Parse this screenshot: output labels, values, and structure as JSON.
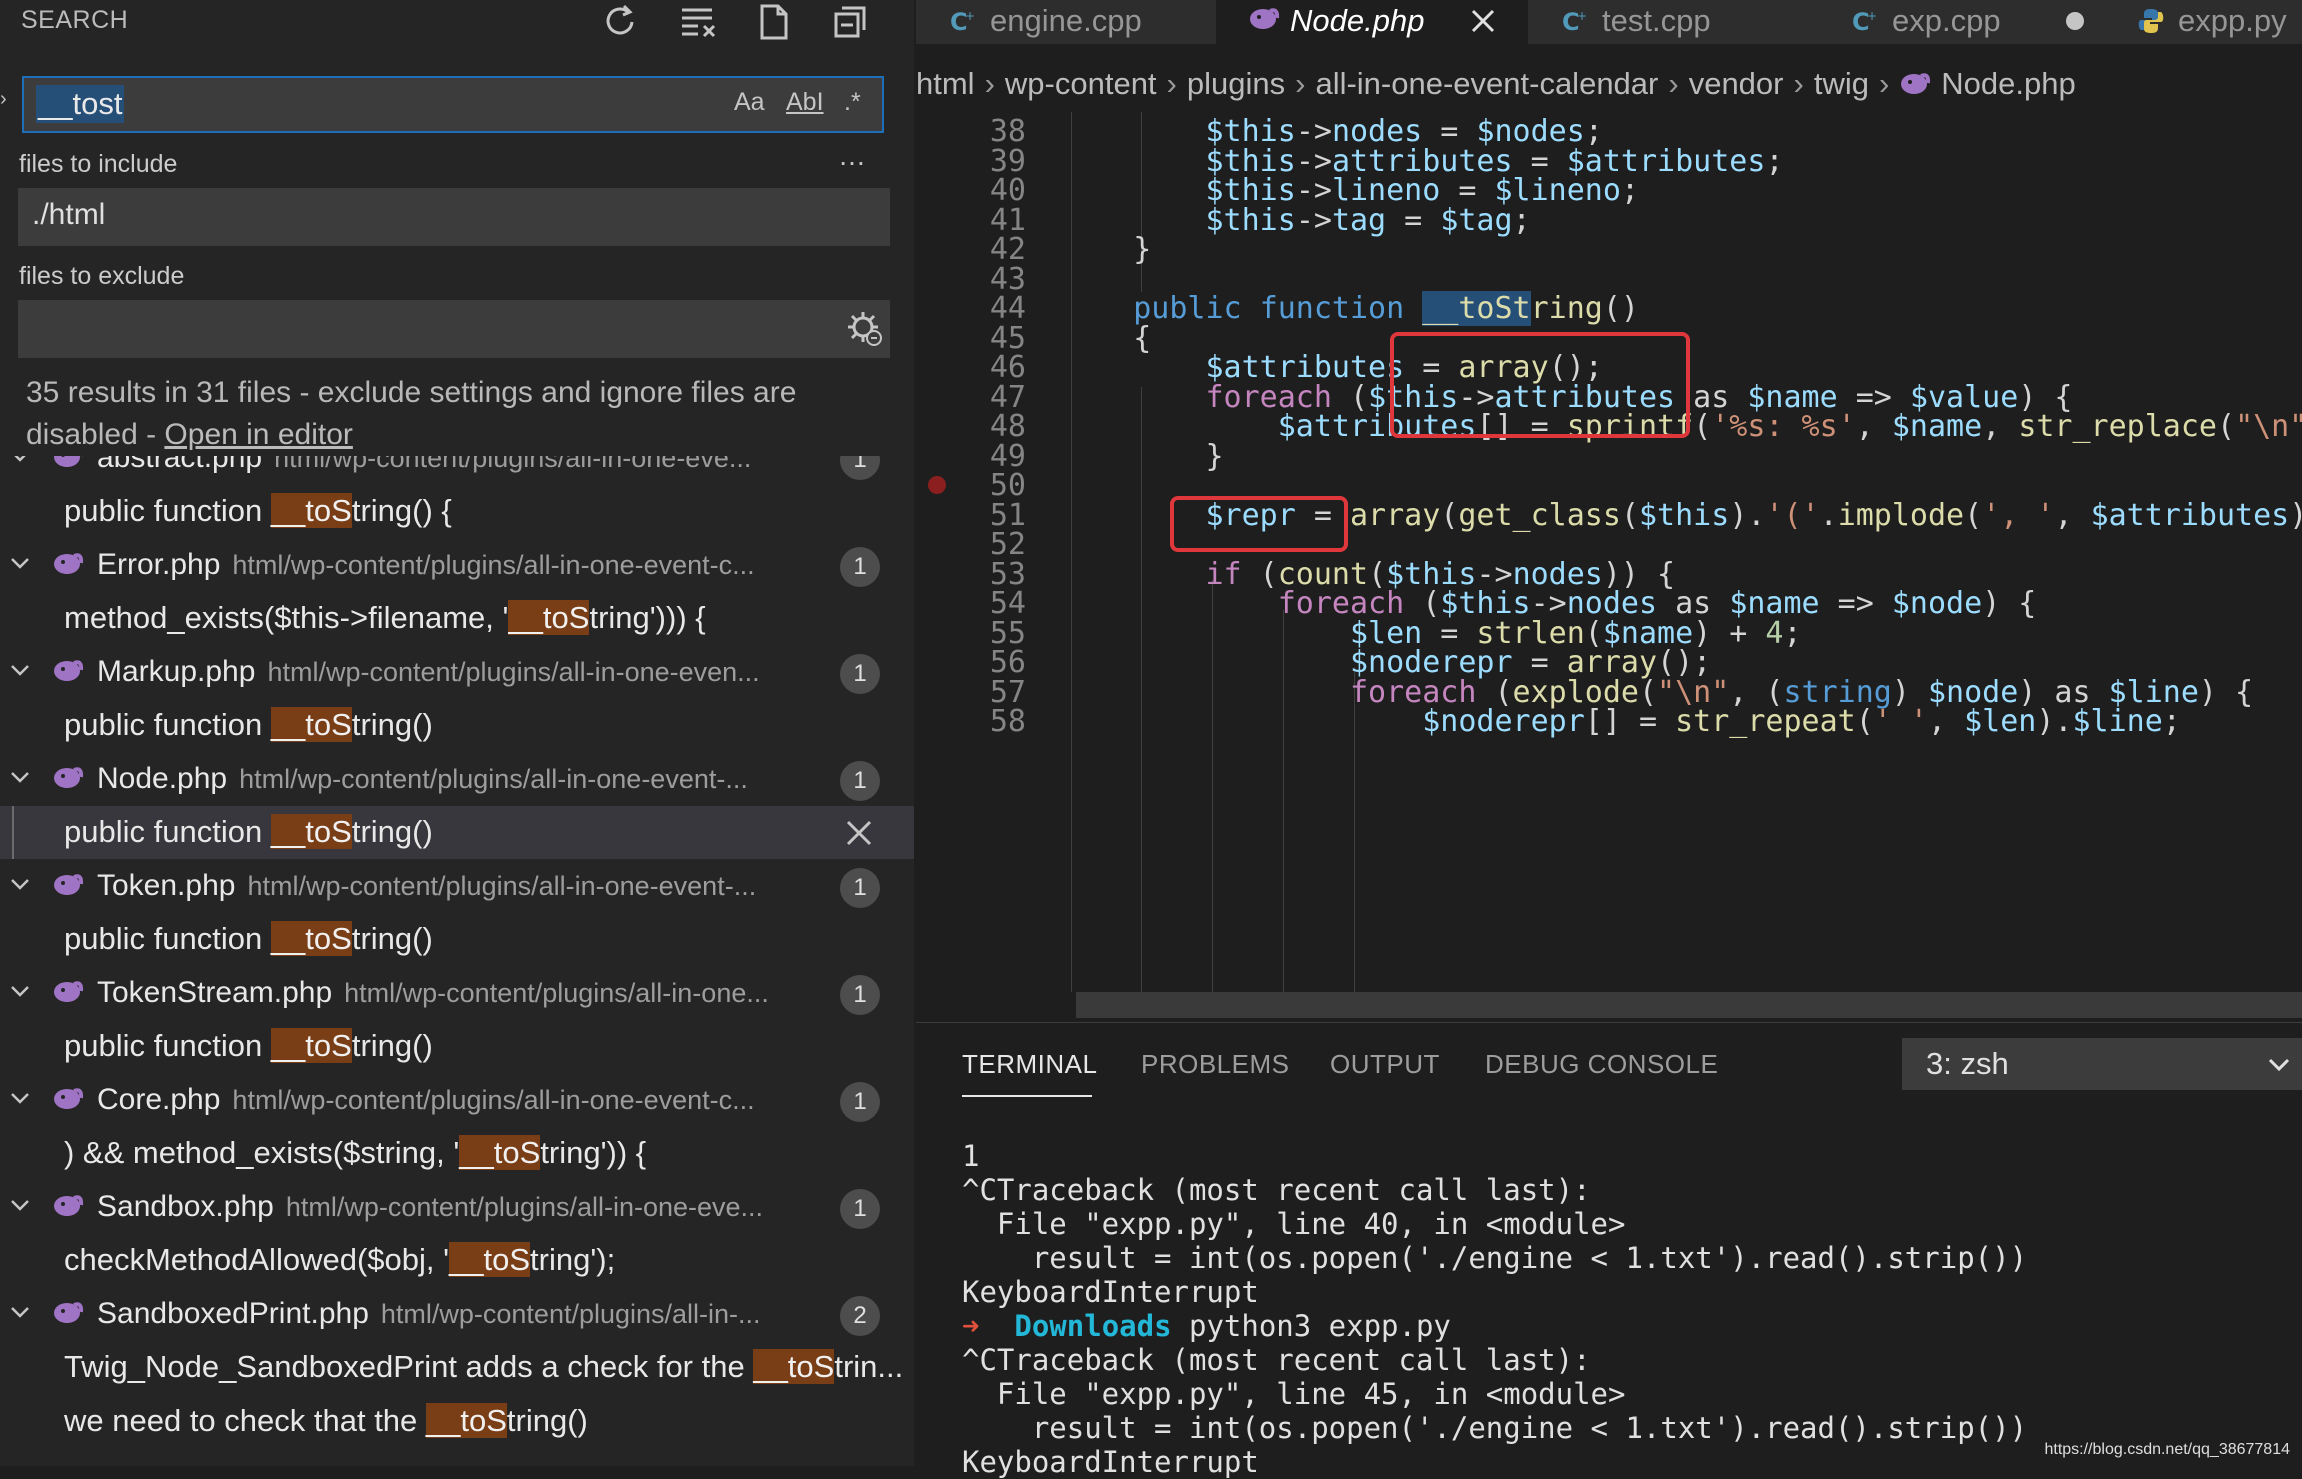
{
  "search_panel": {
    "title": "SEARCH",
    "query": "__tost",
    "option_case": "Aa",
    "option_word": "AbI",
    "option_regex": ".*",
    "more": "…",
    "include_label": "files to include",
    "include_value": "./html",
    "exclude_label": "files to exclude",
    "exclude_value": "",
    "results_message": "35 results in 31 files - exclude settings and ignore files are disabled - ",
    "open_in_editor": "Open in editor",
    "results": [
      {
        "kind": "file",
        "name": "abstract.php",
        "path": "html/wp-content/plugins/all-in-one-eve...",
        "count": "1"
      },
      {
        "kind": "match",
        "pre": "public function ",
        "hl": "__toS",
        "post": "tring() {"
      },
      {
        "kind": "file",
        "name": "Error.php",
        "path": "html/wp-content/plugins/all-in-one-event-c...",
        "count": "1"
      },
      {
        "kind": "match",
        "pre": "method_exists($this->filename, '",
        "hl": "__toS",
        "post": "tring'))) {"
      },
      {
        "kind": "file",
        "name": "Markup.php",
        "path": "html/wp-content/plugins/all-in-one-even...",
        "count": "1"
      },
      {
        "kind": "match",
        "pre": "public function ",
        "hl": "__toS",
        "post": "tring()"
      },
      {
        "kind": "file",
        "name": "Node.php",
        "path": "html/wp-content/plugins/all-in-one-event-...",
        "count": "1"
      },
      {
        "kind": "match",
        "pre": "public function ",
        "hl": "__toS",
        "post": "tring()",
        "active": true
      },
      {
        "kind": "file",
        "name": "Token.php",
        "path": "html/wp-content/plugins/all-in-one-event-...",
        "count": "1"
      },
      {
        "kind": "match",
        "pre": "public function ",
        "hl": "__toS",
        "post": "tring()"
      },
      {
        "kind": "file",
        "name": "TokenStream.php",
        "path": "html/wp-content/plugins/all-in-one...",
        "count": "1"
      },
      {
        "kind": "match",
        "pre": "public function ",
        "hl": "__toS",
        "post": "tring()"
      },
      {
        "kind": "file",
        "name": "Core.php",
        "path": "html/wp-content/plugins/all-in-one-event-c...",
        "count": "1"
      },
      {
        "kind": "match",
        "pre": ") && method_exists($string, '",
        "hl": "__toS",
        "post": "tring')) {"
      },
      {
        "kind": "file",
        "name": "Sandbox.php",
        "path": "html/wp-content/plugins/all-in-one-eve...",
        "count": "1"
      },
      {
        "kind": "match",
        "pre": "checkMethodAllowed($obj, '",
        "hl": "__toS",
        "post": "tring');"
      },
      {
        "kind": "file",
        "name": "SandboxedPrint.php",
        "path": "html/wp-content/plugins/all-in-...",
        "count": "2"
      },
      {
        "kind": "match",
        "pre": "Twig_Node_SandboxedPrint adds a check for the ",
        "hl": "__toS",
        "post": "trin..."
      },
      {
        "kind": "match",
        "pre": "we need to check that the ",
        "hl": "__toS",
        "post": "tring()"
      }
    ]
  },
  "tabs": [
    {
      "label": "engine.cpp",
      "icon": "cpp-icon"
    },
    {
      "label": "Node.php",
      "icon": "php-icon",
      "active": true
    },
    {
      "label": "test.cpp",
      "icon": "cpp-icon"
    },
    {
      "label": "exp.cpp",
      "icon": "cpp-icon",
      "modified": true
    },
    {
      "label": "expp.py",
      "icon": "python-icon"
    }
  ],
  "breadcrumb": [
    "html",
    "wp-content",
    "plugins",
    "all-in-one-event-calendar",
    "vendor",
    "twig",
    "Node.php"
  ],
  "code_lines": [
    {
      "n": "38",
      "html": "        <span class='var'>$this</span>-><span class='var'>nodes</span> = <span class='var'>$nodes</span>;"
    },
    {
      "n": "39",
      "html": "        <span class='var'>$this</span>-><span class='var'>attributes</span> = <span class='var'>$attributes</span>;"
    },
    {
      "n": "40",
      "html": "        <span class='var'>$this</span>-><span class='var'>lineno</span> = <span class='var'>$lineno</span>;"
    },
    {
      "n": "41",
      "html": "        <span class='var'>$this</span>-><span class='var'>tag</span> = <span class='var'>$tag</span>;"
    },
    {
      "n": "42",
      "html": "    }"
    },
    {
      "n": "43",
      "html": ""
    },
    {
      "n": "44",
      "html": "    <span class='kw'>public</span> <span class='kw'>function</span> <span class='fn'><span class='code-hl'>__toSt</span>ring</span>()"
    },
    {
      "n": "45",
      "html": "    {"
    },
    {
      "n": "46",
      "html": "        <span class='var'>$attributes</span> = <span class='fn'>array</span>();"
    },
    {
      "n": "47",
      "html": "        <span class='kw2'>foreach</span> (<span class='var'>$this</span>-><span class='var'>attributes</span> as <span class='var'>$name</span> => <span class='var'>$value</span>) {"
    },
    {
      "n": "48",
      "html": "            <span class='var'>$attributes</span>[] = <span class='fn'>sprintf</span>(<span class='str'>'%s: %s'</span>, <span class='var'>$name</span>, <span class='fn'>str_replace</span>(<span class='str'>\"\\n\"</span>,"
    },
    {
      "n": "49",
      "html": "        }"
    },
    {
      "n": "50",
      "html": "",
      "breakpoint": true
    },
    {
      "n": "51",
      "html": "        <span class='var'>$repr</span> = <span class='fn'>array</span>(<span class='fn'>get_class</span>(<span class='var'>$this</span>).<span class='str'>'('</span>.<span class='fn'>implode</span>(<span class='str'>', '</span>, <span class='var'>$attributes</span>));"
    },
    {
      "n": "52",
      "html": ""
    },
    {
      "n": "53",
      "html": "        <span class='kw2'>if</span> (<span class='fn'>count</span>(<span class='var'>$this</span>-><span class='var'>nodes</span>)) {"
    },
    {
      "n": "54",
      "html": "            <span class='kw2'>foreach</span> (<span class='var'>$this</span>-><span class='var'>nodes</span> as <span class='var'>$name</span> => <span class='var'>$node</span>) {"
    },
    {
      "n": "55",
      "html": "                <span class='var'>$len</span> = <span class='fn'>strlen</span>(<span class='var'>$name</span>) + <span class='num'>4</span>;"
    },
    {
      "n": "56",
      "html": "                <span class='var'>$noderepr</span> = <span class='fn'>array</span>();"
    },
    {
      "n": "57",
      "html": "                <span class='kw2'>foreach</span> (<span class='fn'>explode</span>(<span class='str'>\"\\n\"</span>, (<span class='kw'>string</span>) <span class='var'>$node</span>) as <span class='var'>$line</span>) {"
    },
    {
      "n": "58",
      "html": "                    <span class='var'>$noderepr</span>[] = <span class='fn'>str_repeat</span>(<span class='str'>' '</span>, <span class='var'>$len</span>).<span class='var'>$line</span>;"
    }
  ],
  "panel": {
    "tabs": [
      "TERMINAL",
      "PROBLEMS",
      "OUTPUT",
      "DEBUG CONSOLE"
    ],
    "active_tab": "TERMINAL",
    "terminal_select": "3: zsh",
    "lines": [
      {
        "text": "1"
      },
      {
        "text": "^CTraceback (most recent call last):"
      },
      {
        "text": "  File \"expp.py\", line 40, in <module>"
      },
      {
        "text": "    result = int(os.popen('./engine < 1.txt').read().strip())"
      },
      {
        "text": "KeyboardInterrupt"
      },
      {
        "prompt": true,
        "arrow": "➜",
        "dir": "Downloads",
        "text": " python3 expp.py"
      },
      {
        "text": "^CTraceback (most recent call last):"
      },
      {
        "text": "  File \"expp.py\", line 45, in <module>"
      },
      {
        "text": "    result = int(os.popen('./engine < 1.txt').read().strip())"
      },
      {
        "text": "KeyboardInterrupt"
      }
    ]
  },
  "watermark": "https://blog.csdn.net/qq_38677814",
  "colors": {
    "accent": "#1c6fb8",
    "match_highlight": "#7a3e16",
    "annotation_red": "#e0373d",
    "php_icon": "#a074c4"
  }
}
